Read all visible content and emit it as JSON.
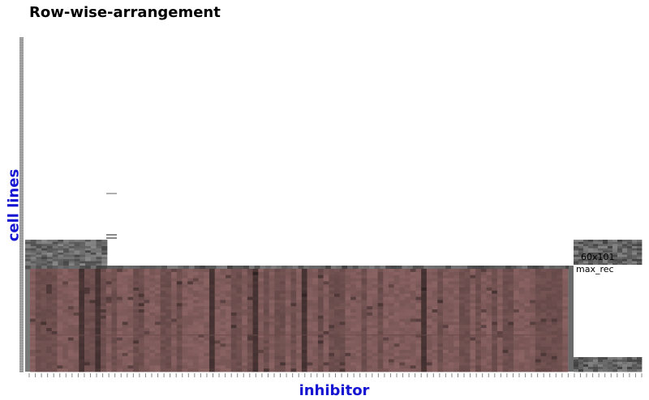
{
  "title": "Row-wise-arrangement",
  "chart_data": {
    "type": "heatmap",
    "title": "Row-wise-arrangement",
    "xlabel": "inhibitor",
    "ylabel": "cell lines",
    "dimensions_label": "60x101",
    "highlight_label": "max_rec",
    "n_rows": 60,
    "n_cols": 101,
    "colors": {
      "label_blue": "#1414d2",
      "highlight_fill": "#8c6464",
      "cell_gray": "#6e6e6e"
    }
  }
}
